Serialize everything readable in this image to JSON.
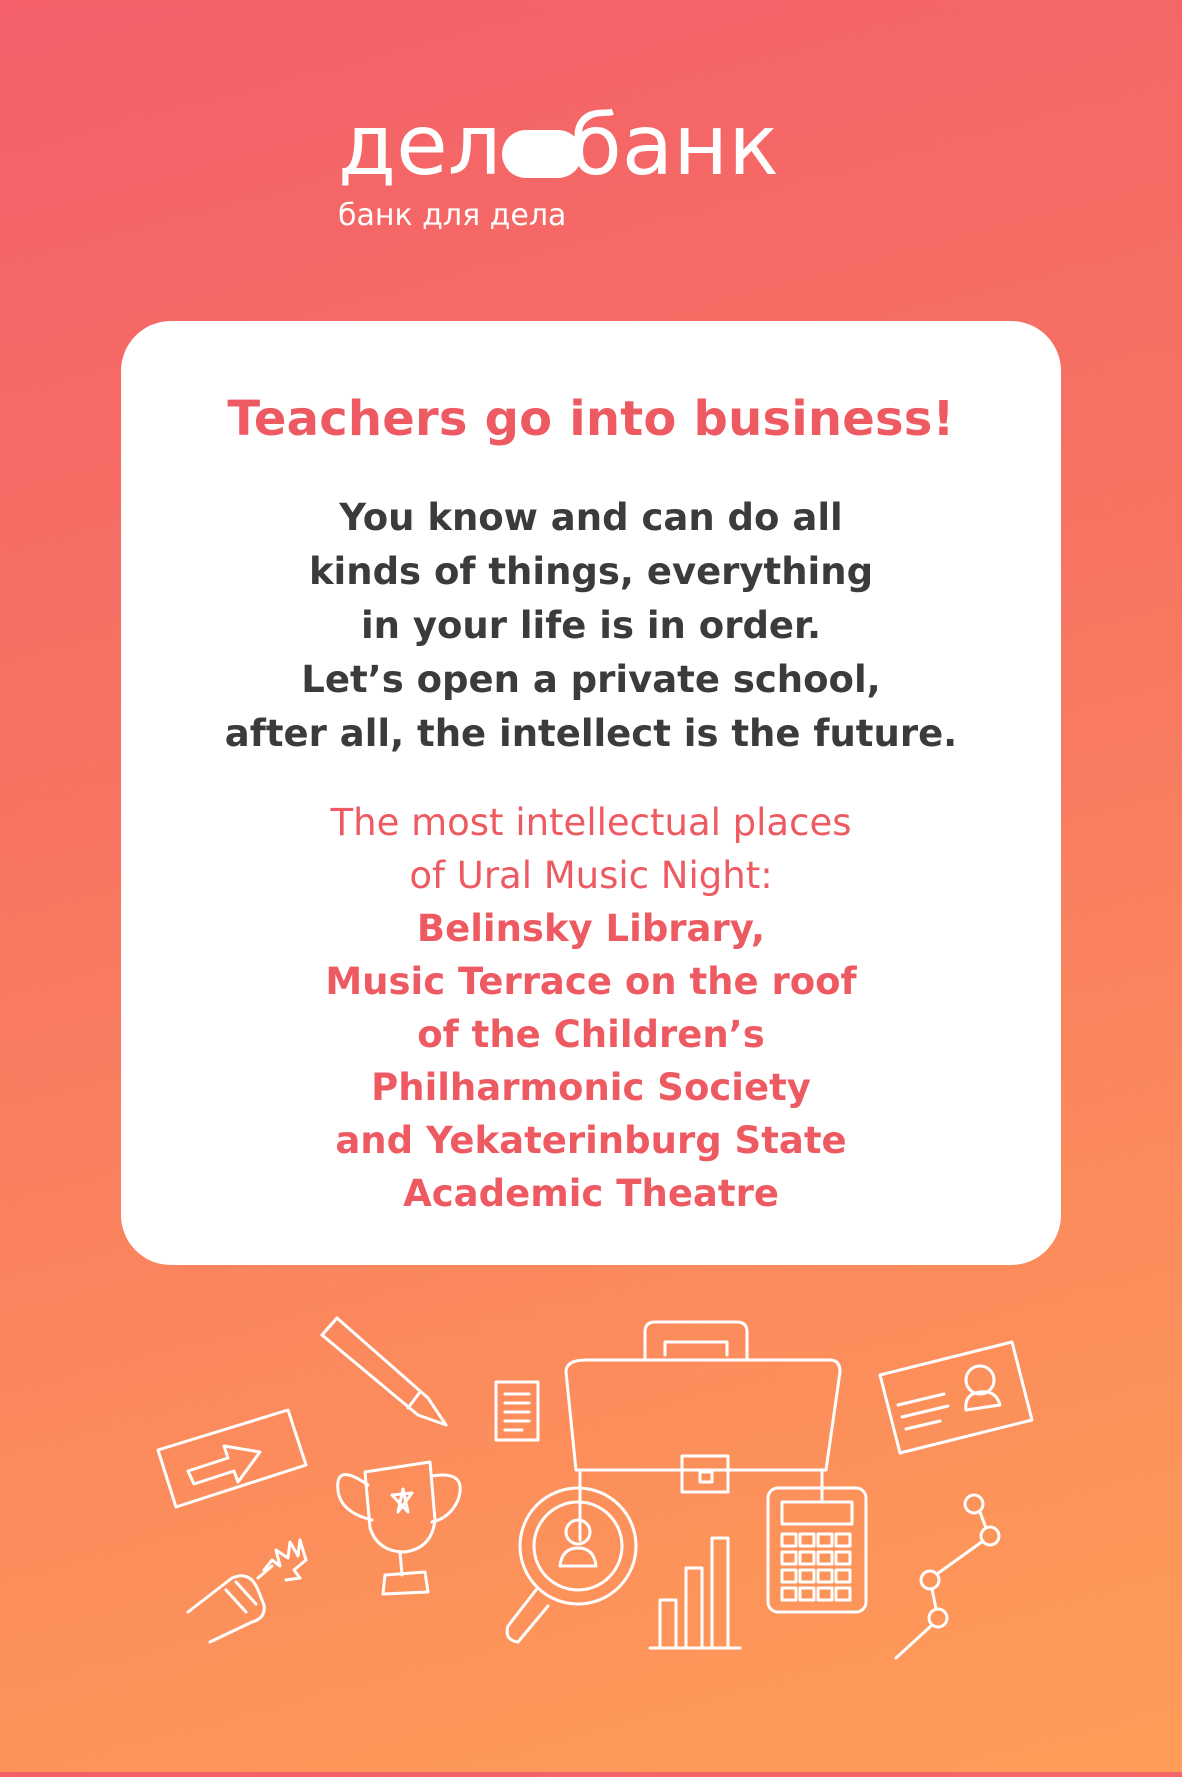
{
  "logo": {
    "wordmark_left": "дел",
    "wordmark_right": "банк",
    "tagline": "банк для дела"
  },
  "card": {
    "headline": "Teachers go into business!",
    "body_lines": [
      "You know and can do all",
      "kinds of things, everything",
      "in your life is in order.",
      "Let’s open a private school,",
      "after all, the intellect is the future."
    ],
    "places_intro_lines": [
      "The most intellectual places",
      "of Ural Music Night:"
    ],
    "places_lines": [
      "Belinsky Library,",
      "Music Terrace on the roof",
      "of the Children’s",
      "Philharmonic Society",
      "and  Yekaterinburg State",
      "Academic Theatre"
    ]
  },
  "colors": {
    "background_top": "#f45f6a",
    "background_bottom": "#ff9d59",
    "accent": "#ee5a62",
    "body_text": "#3a3b3c",
    "card": "#ffffff"
  },
  "illustration": {
    "icons": [
      "pencil-icon",
      "arrow-ticket-icon",
      "document-icon",
      "briefcase-icon",
      "id-card-icon",
      "trophy-icon",
      "microphone-icon",
      "magnifier-user-icon",
      "bar-chart-icon",
      "calculator-icon",
      "line-graph-icon"
    ]
  }
}
